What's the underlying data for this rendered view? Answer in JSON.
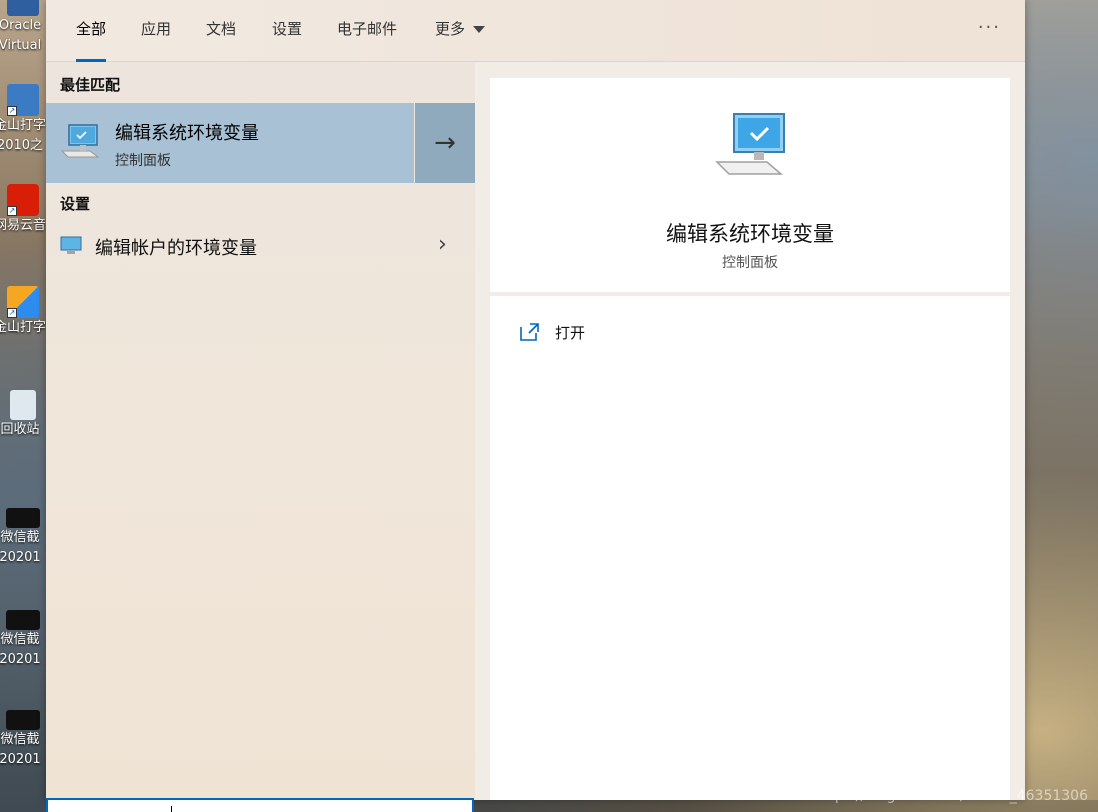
{
  "desktop": {
    "icons": [
      {
        "label": "Oracle\nVirtual"
      },
      {
        "label": "金山打字\n2010之"
      },
      {
        "label": "网易云音"
      },
      {
        "label": "金山打字"
      },
      {
        "label": "回收站"
      },
      {
        "label": "微信截\n20201"
      },
      {
        "label": "微信截\n20201"
      },
      {
        "label": "微信截\n20201"
      }
    ]
  },
  "tabs": [
    {
      "label": "全部"
    },
    {
      "label": "应用"
    },
    {
      "label": "文档"
    },
    {
      "label": "设置"
    },
    {
      "label": "电子邮件"
    },
    {
      "label": "更多"
    }
  ],
  "more_options": "···",
  "left": {
    "best_match_heading": "最佳匹配",
    "best_match": {
      "title": "编辑系统环境变量",
      "subtitle": "控制面板"
    },
    "settings_heading": "设置",
    "settings_items": [
      {
        "label": "编辑帐户的环境变量"
      }
    ]
  },
  "right": {
    "title": "编辑系统环境变量",
    "subtitle": "控制面板",
    "actions": [
      {
        "label": "打开",
        "icon": "open-window-icon"
      }
    ]
  },
  "colors": {
    "accent": "#0067c0",
    "selected_row": "#a9c1d4"
  },
  "watermark": "https://blog.csdn.net/weixin_46351306"
}
